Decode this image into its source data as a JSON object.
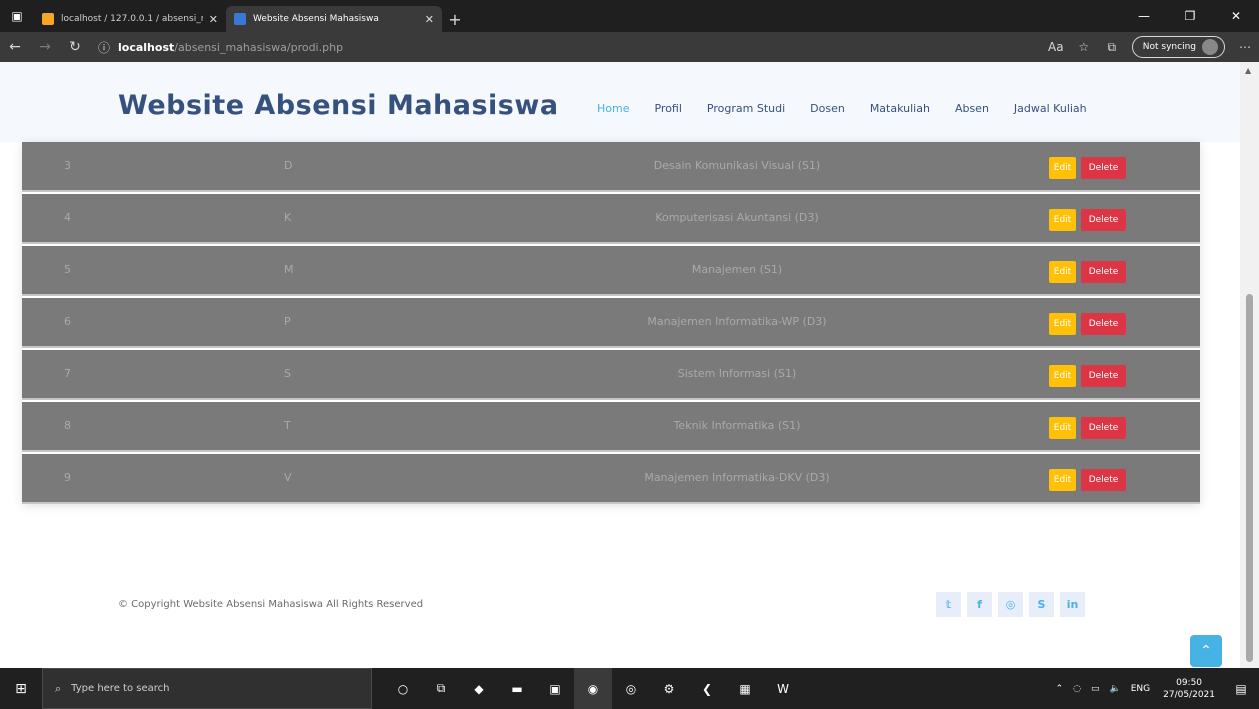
{
  "browser": {
    "tabs": [
      {
        "title": "localhost / 127.0.0.1 / absensi_m",
        "active": false
      },
      {
        "title": "Website Absensi Mahasiswa",
        "active": true
      }
    ],
    "url_host": "localhost",
    "url_path": "/absensi_mahasiswa/prodi.php",
    "sync_label": "Not syncing"
  },
  "site": {
    "brand": "Website Absensi Mahasiswa",
    "nav": [
      {
        "label": "Home",
        "active": true
      },
      {
        "label": "Profil",
        "active": false
      },
      {
        "label": "Program Studi",
        "active": false
      },
      {
        "label": "Dosen",
        "active": false
      },
      {
        "label": "Matakuliah",
        "active": false
      },
      {
        "label": "Absen",
        "active": false
      },
      {
        "label": "Jadwal Kuliah",
        "active": false
      }
    ]
  },
  "table": {
    "edit_label": "Edit",
    "delete_label": "Delete",
    "rows": [
      {
        "no": "3",
        "code": "D",
        "name": "Desain Komunikasi Visual (S1)"
      },
      {
        "no": "4",
        "code": "K",
        "name": "Komputerisasi Akuntansi (D3)"
      },
      {
        "no": "5",
        "code": "M",
        "name": "Manajemen (S1)"
      },
      {
        "no": "6",
        "code": "P",
        "name": "Manajemen Informatika-WP (D3)"
      },
      {
        "no": "7",
        "code": "S",
        "name": "Sistem Informasi (S1)"
      },
      {
        "no": "8",
        "code": "T",
        "name": "Teknik Informatika (S1)"
      },
      {
        "no": "9",
        "code": "V",
        "name": "Manajemen Informatika-DKV (D3)"
      }
    ]
  },
  "footer": {
    "copyright": "© Copyright Website Absensi Mahasiswa All Rights Reserved",
    "social": [
      "twitter-icon",
      "facebook-icon",
      "instagram-icon",
      "skype-icon",
      "linkedin-icon"
    ]
  },
  "taskbar": {
    "search_placeholder": "Type here to search",
    "language": "ENG",
    "time": "09:50",
    "date": "27/05/2021"
  },
  "colors": {
    "brand": "#37517e",
    "nav_active": "#47b2e4",
    "row_bg": "#7a7a7a",
    "edit": "#ffc107",
    "delete": "#dc3545"
  }
}
